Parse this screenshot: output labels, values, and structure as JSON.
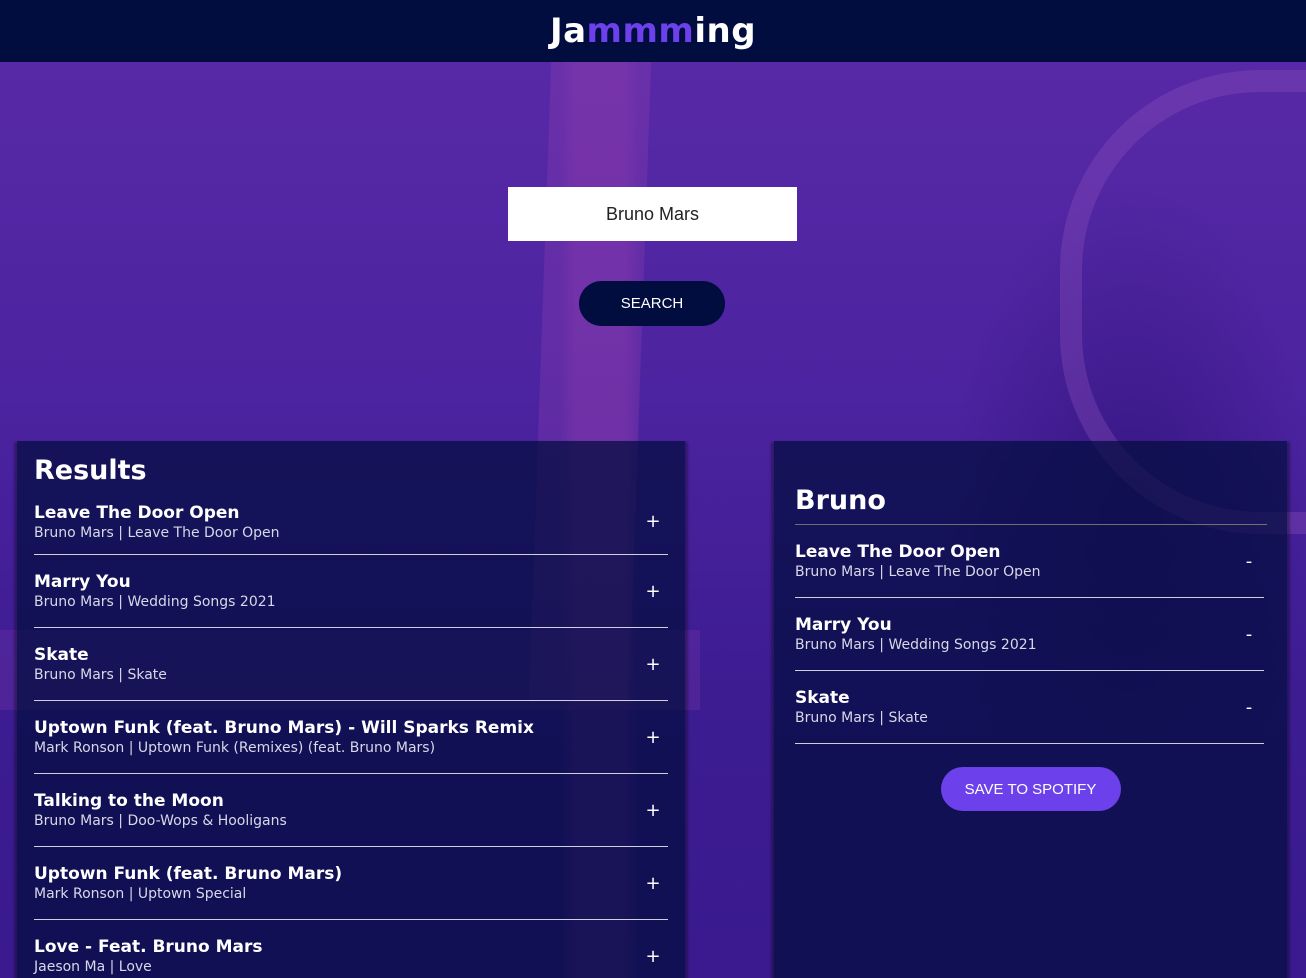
{
  "header": {
    "logo_prefix": "Ja",
    "logo_highlight": "mmm",
    "logo_suffix": "ing"
  },
  "search": {
    "value": "Bruno Mars",
    "button_label": "SEARCH"
  },
  "results": {
    "title": "Results",
    "action_icon": "+",
    "tracks": [
      {
        "name": "Leave The Door Open",
        "meta": "Bruno Mars | Leave The Door Open"
      },
      {
        "name": "Marry You",
        "meta": "Bruno Mars | Wedding Songs 2021"
      },
      {
        "name": "Skate",
        "meta": "Bruno Mars | Skate"
      },
      {
        "name": "Uptown Funk (feat. Bruno Mars) - Will Sparks Remix",
        "meta": "Mark Ronson | Uptown Funk (Remixes) (feat. Bruno Mars)"
      },
      {
        "name": "Talking to the Moon",
        "meta": "Bruno Mars | Doo-Wops & Hooligans"
      },
      {
        "name": "Uptown Funk (feat. Bruno Mars)",
        "meta": "Mark Ronson | Uptown Special"
      },
      {
        "name": "Love - Feat. Bruno Mars",
        "meta": "Jaeson Ma | Love"
      }
    ]
  },
  "playlist": {
    "name": "Bruno",
    "action_icon": "-",
    "tracks": [
      {
        "name": "Leave The Door Open",
        "meta": "Bruno Mars | Leave The Door Open"
      },
      {
        "name": "Marry You",
        "meta": "Bruno Mars | Wedding Songs 2021"
      },
      {
        "name": "Skate",
        "meta": "Bruno Mars | Skate"
      }
    ],
    "save_label": "SAVE TO SPOTIFY"
  },
  "colors": {
    "header_bg": "#010c3f",
    "accent": "#6c41ec",
    "background": "#4c23a0"
  }
}
